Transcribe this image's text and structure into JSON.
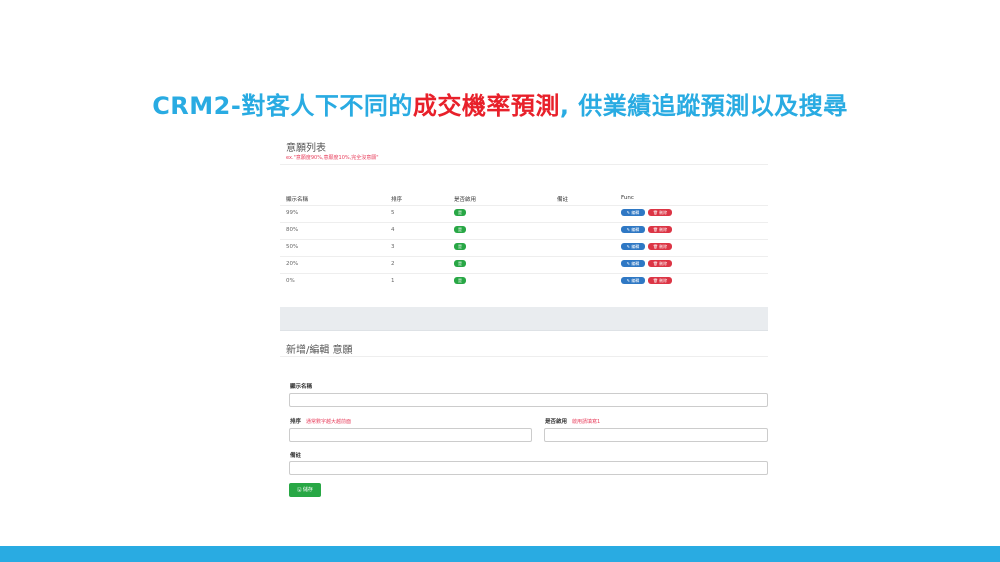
{
  "slide": {
    "title_prefix": "CRM2-對客人下不同的",
    "title_highlight": "成交機率預測",
    "title_suffix": ", 供業績追蹤預測以及搜尋"
  },
  "list_section": {
    "title": "意願列表",
    "hint": "ex.\"意願度90%,意願度10%,完全沒意願\"",
    "columns": [
      "顯示名稱",
      "排序",
      "是否啟用",
      "備註",
      "Func"
    ],
    "rows": [
      {
        "name": "99%",
        "order": "5",
        "enabled": "是",
        "note": ""
      },
      {
        "name": "80%",
        "order": "4",
        "enabled": "是",
        "note": ""
      },
      {
        "name": "50%",
        "order": "3",
        "enabled": "是",
        "note": ""
      },
      {
        "name": "20%",
        "order": "2",
        "enabled": "是",
        "note": ""
      },
      {
        "name": "0%",
        "order": "1",
        "enabled": "是",
        "note": ""
      }
    ],
    "edit_label": "編輯",
    "delete_label": "刪除"
  },
  "form_section": {
    "title": "新增/編輯 意願",
    "name_label": "顯示名稱",
    "order_label": "排序",
    "order_hint": "通常數字越大越前面",
    "enabled_label": "是否啟用",
    "enabled_hint": "啟用請填寫1",
    "note_label": "備註",
    "save_label": "儲存"
  },
  "colors": {
    "accent": "#29abe2",
    "highlight": "#e8202a",
    "success": "#28a745",
    "primary": "#2f78c4",
    "danger": "#dc3545"
  }
}
